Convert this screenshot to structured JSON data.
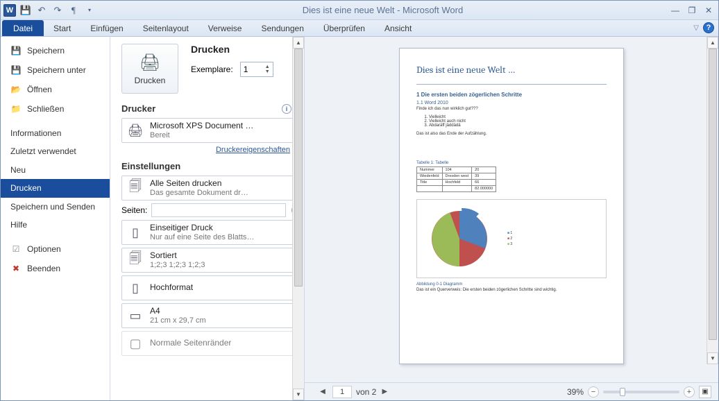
{
  "title": "Dies ist eine neue Welt  -  Microsoft Word",
  "ribbon": {
    "file": "Datei",
    "tabs": [
      "Start",
      "Einfügen",
      "Seitenlayout",
      "Verweise",
      "Sendungen",
      "Überprüfen",
      "Ansicht"
    ]
  },
  "backstage_nav": {
    "save": "Speichern",
    "save_as": "Speichern unter",
    "open": "Öffnen",
    "close": "Schließen",
    "info": "Informationen",
    "recent": "Zuletzt verwendet",
    "new": "Neu",
    "print": "Drucken",
    "save_send": "Speichern und Senden",
    "help": "Hilfe",
    "options": "Optionen",
    "exit": "Beenden"
  },
  "print": {
    "heading": "Drucken",
    "button": "Drucken",
    "copies_label": "Exemplare:",
    "copies_value": "1",
    "printer_heading": "Drucker",
    "printer_name": "Microsoft XPS Document …",
    "printer_status": "Bereit",
    "printer_props": "Druckereigenschaften",
    "settings_heading": "Einstellungen",
    "scope_title": "Alle Seiten drucken",
    "scope_sub": "Das gesamte Dokument dr…",
    "pages_label": "Seiten:",
    "duplex_title": "Einseitiger Druck",
    "duplex_sub": "Nur auf eine Seite des Blatts…",
    "collate_title": "Sortiert",
    "collate_sub": "1;2;3   1;2;3   1;2;3",
    "orient": "Hochformat",
    "paper_title": "A4",
    "paper_sub": "21  cm x 29,7  cm",
    "margins": "Normale Seitenränder"
  },
  "preview": {
    "page_current": "1",
    "page_total": "von 2",
    "zoom": "39%",
    "doc": {
      "title": "Dies ist eine neue Welt …",
      "h1": "1    Die ersten beiden zögerlichen Schritte",
      "h11": "1.1   Word 2010",
      "q": "Finde ich das nun wirklich gut???",
      "li1": "Vielleicht",
      "li2": "Vielleicht auch nicht",
      "li3": "Abdaräff jäddädä",
      "endline": "Das ist also das Ende der Aufzählung.",
      "tcap": "Tabelle 1: Tabelle",
      "figcap": "Abbildung 0-1 Diagramm",
      "foot": "Das ist ein Querverweis: Die ersten beiden zögerlichen Schritte sind wichtig."
    }
  }
}
